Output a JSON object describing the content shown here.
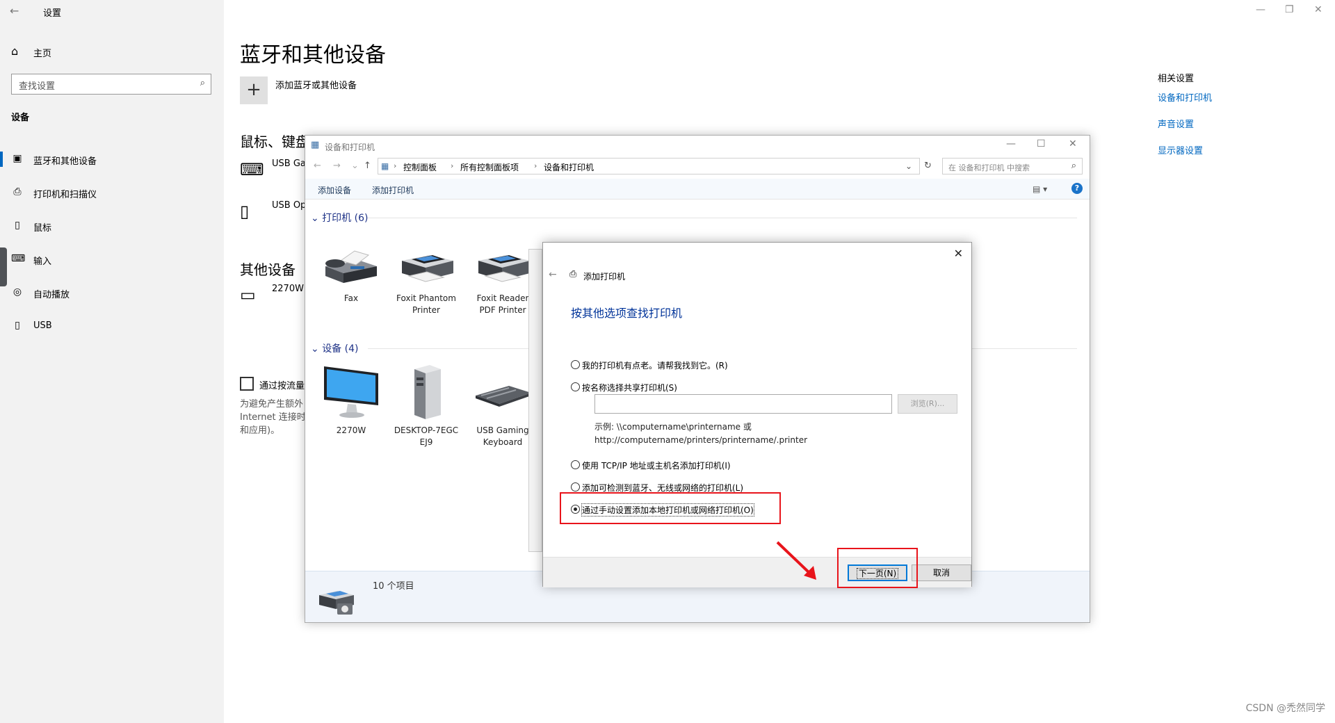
{
  "settings": {
    "app_title": "设置",
    "home": "主页",
    "search_placeholder": "查找设置",
    "section": "设备",
    "nav": [
      "蓝牙和其他设备",
      "打印机和扫描仪",
      "鼠标",
      "输入",
      "自动播放",
      "USB"
    ],
    "page_title": "蓝牙和其他设备",
    "add_device": "添加蓝牙或其他设备",
    "sections": {
      "mouse_keyboard": "鼠标、键盘和笔",
      "other": "其他设备"
    },
    "devices": [
      "USB Ga",
      "USB Op"
    ],
    "other_devices": [
      "2270W"
    ],
    "metered_label": "通过按流量",
    "metered_desc": "为避免产生额外\nInternet 连接时\n和应用)。"
  },
  "related": {
    "heading": "相关设置",
    "links": [
      "设备和打印机",
      "声音设置",
      "显示器设置"
    ]
  },
  "devices_printers": {
    "title": "设备和打印机",
    "breadcrumb": [
      "控制面板",
      "所有控制面板项",
      "设备和打印机"
    ],
    "search_placeholder": "在 设备和打印机 中搜索",
    "commands": [
      "添加设备",
      "添加打印机"
    ],
    "printers_header": "打印机 (6)",
    "printers": [
      [
        "Fax"
      ],
      [
        "Foxit Phantom",
        "Printer"
      ],
      [
        "Foxit Reader",
        "PDF Printer"
      ]
    ],
    "devices_header": "设备 (4)",
    "devices": [
      [
        "2270W"
      ],
      [
        "DESKTOP-7EGC",
        "EJ9"
      ],
      [
        "USB Gaming",
        "Keyboard"
      ]
    ],
    "status": "10 个项目"
  },
  "add_printer": {
    "title": "添加打印机",
    "heading": "按其他选项查找打印机",
    "options": [
      "我的打印机有点老。请帮我找到它。(R)",
      "按名称选择共享打印机(S)",
      "使用 TCP/IP 地址或主机名添加打印机(I)",
      "添加可检测到蓝牙、无线或网络的打印机(L)",
      "通过手动设置添加本地打印机或网络打印机(O)"
    ],
    "selected_index": 4,
    "browse": "浏览(R)...",
    "example_line1": "示例: \\\\computername\\printername 或",
    "example_line2": "http://computername/printers/printername/.printer",
    "next": "下一页(N)",
    "cancel": "取消"
  },
  "watermark": "CSDN @禿然同学",
  "colors": {
    "accent": "#0067c0",
    "annotation": "#e8141b",
    "link": "#0067c0"
  }
}
